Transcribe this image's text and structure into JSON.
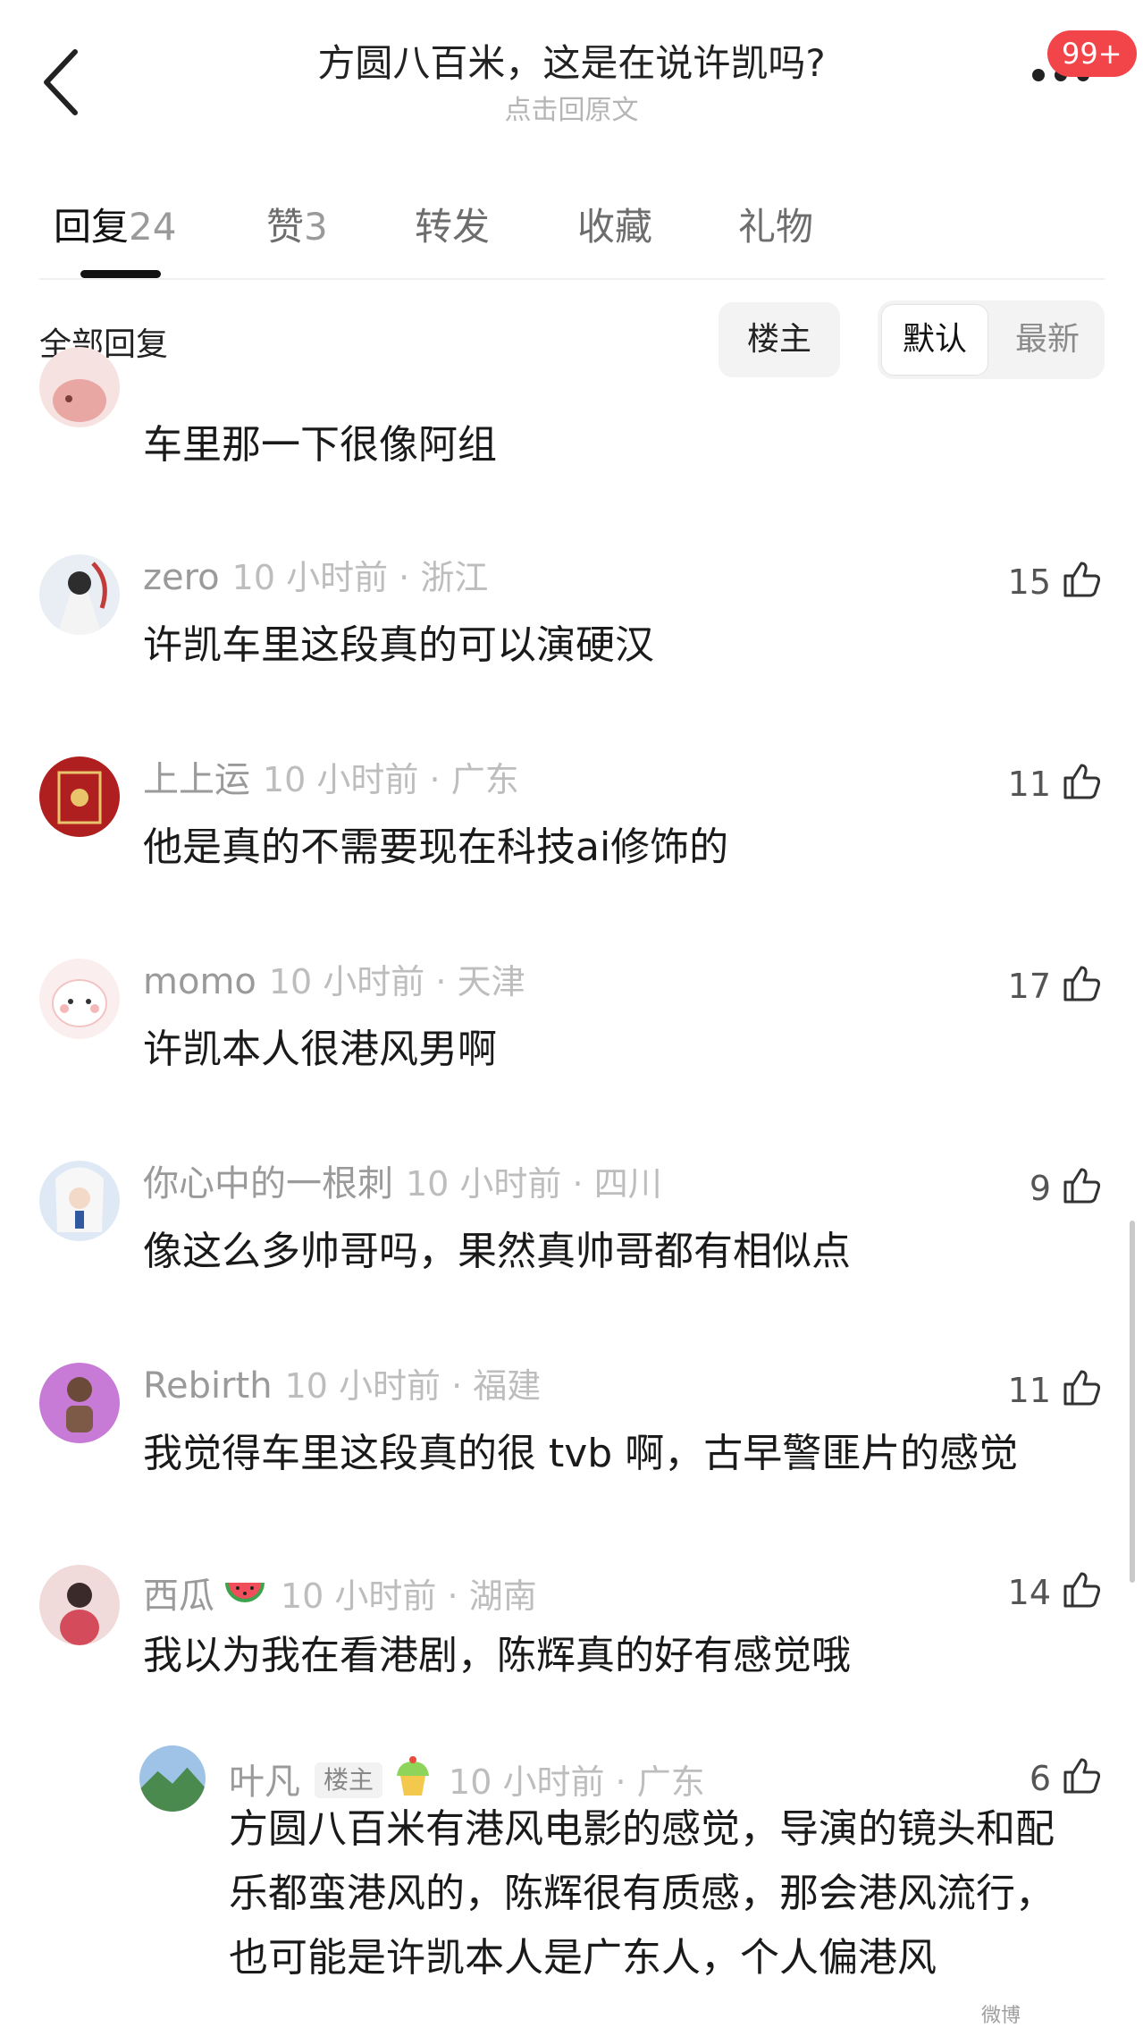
{
  "header": {
    "title": "方圆八百米，这是在说许凯吗?",
    "subtitle": "点击回原文",
    "badge": "99+"
  },
  "tabs": [
    {
      "label": "回复",
      "count": "24"
    },
    {
      "label": "赞",
      "count": "3"
    },
    {
      "label": "转发",
      "count": ""
    },
    {
      "label": "收藏",
      "count": ""
    },
    {
      "label": "礼物",
      "count": ""
    }
  ],
  "filters": {
    "all_replies": "全部回复",
    "op_only": "楼主",
    "sort_default": "默认",
    "sort_latest": "最新"
  },
  "comments": [
    {
      "name": "",
      "time": "",
      "location": "",
      "likes": "",
      "text": "车里那一下很像阿组"
    },
    {
      "name": "zero",
      "time": "10 小时前",
      "location": "浙江",
      "likes": "15",
      "text": "许凯车里这段真的可以演硬汉"
    },
    {
      "name": "上上运",
      "time": "10 小时前",
      "location": "广东",
      "likes": "11",
      "text": "他是真的不需要现在科技ai修饰的"
    },
    {
      "name": "momo",
      "time": "10 小时前",
      "location": "天津",
      "likes": "17",
      "text": "许凯本人很港风男啊"
    },
    {
      "name": "你心中的一根刺",
      "time": "10 小时前",
      "location": "四川",
      "likes": "9",
      "text": "像这么多帅哥吗，果然真帅哥都有相似点"
    },
    {
      "name": "Rebirth",
      "time": "10 小时前",
      "location": "福建",
      "likes": "11",
      "text": "我觉得车里这段真的很 tvb 啊，古早警匪片的感觉"
    },
    {
      "name": "西瓜",
      "time": "10 小时前",
      "location": "湖南",
      "likes": "14",
      "text": "我以为我在看港剧，陈辉真的好有感觉哦"
    }
  ],
  "reply": {
    "name": "叶凡",
    "op_tag": "楼主",
    "time": "10 小时前",
    "location": "广东",
    "likes": "6",
    "text": "方圆八百米有港风电影的感觉，导演的镜头和配乐都蛮港风的，陈辉很有质感，那会港风流行，也可能是许凯本人是广东人，个人偏港风"
  },
  "watermark": "微博",
  "icons": {
    "back": "back-arrow-icon",
    "more": "more-dots-icon",
    "like": "thumbs-up-icon",
    "emoji_watermelon": "watermelon-emoji",
    "emoji_cupcake": "cupcake-emoji"
  },
  "colors": {
    "badge": "#f2454a",
    "text": "#1a1a1a",
    "muted": "#bdbdbd",
    "name": "#9a9a9a"
  }
}
